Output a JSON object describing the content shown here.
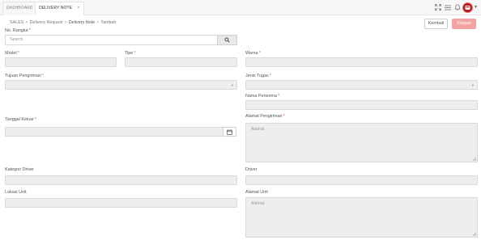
{
  "tabs": [
    {
      "label": "DASHBOARD"
    },
    {
      "label": "DELIVERY NOTE",
      "close": "×"
    }
  ],
  "breadcrumb": {
    "items": [
      "SALES",
      "Delivery Request",
      "Delivery Note",
      "Tambah"
    ],
    "separator": ">"
  },
  "actions": {
    "back_label": "Kembali",
    "save_label": "Simpan"
  },
  "form": {
    "no_rangka": {
      "label": "No. Rangka",
      "required": "*",
      "placeholder": "Search"
    },
    "model": {
      "label": "Model",
      "required": "*"
    },
    "tipe": {
      "label": "Tipe",
      "required": "*"
    },
    "warna": {
      "label": "Warna",
      "required": "*"
    },
    "tujuan_pengiriman": {
      "label": "Tujuan Pengiriman",
      "required": "*"
    },
    "jenis_tugas": {
      "label": "Jenis Tugas",
      "required": "*"
    },
    "nama_penerima": {
      "label": "Nama Penerima",
      "required": "*"
    },
    "alamat_pengiriman": {
      "label": "Alamat Pengiriman",
      "required": "*",
      "placeholder": "Alamat"
    },
    "tanggal_keluar": {
      "label": "Tanggal Keluar",
      "required": "*"
    },
    "kategori_driver": {
      "label": "Kategori Driver"
    },
    "driver": {
      "label": "Driver"
    },
    "lokasi_unit": {
      "label": "Lokasi Unit"
    },
    "alamat_unit": {
      "label": "Alamat Unit",
      "placeholder": "Alamat"
    }
  },
  "icons": {
    "fullscreen": "fullscreen-icon",
    "menu": "hamburger-menu-icon",
    "notification": "bell-icon",
    "search": "search-icon",
    "calendar": "calendar-icon",
    "dropdown": "chevron-down-icon"
  },
  "colors": {
    "accent": "#b71c1c",
    "save_button": "#f2a3a3",
    "required": "#d9534f"
  }
}
